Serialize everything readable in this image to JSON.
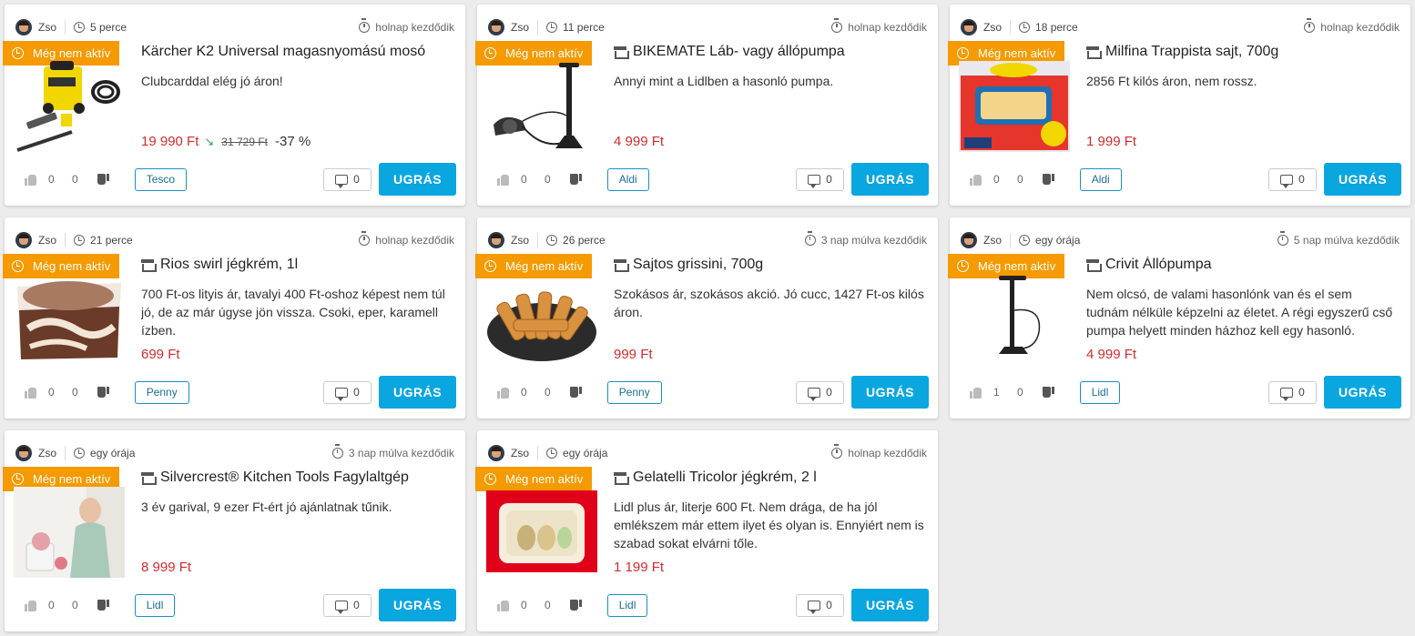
{
  "labels": {
    "inactive_badge": "Még nem aktív",
    "go_button": "UGRÁS"
  },
  "colors": {
    "badge": "#f59a00",
    "price": "#d42b2b",
    "button": "#0aa6e0"
  },
  "deals": [
    {
      "user": "Zso",
      "posted": "5 perce",
      "starts": "holnap kezdődik",
      "store_icon": false,
      "title": "Kärcher K2 Universal magasnyomású mosó",
      "description": "Clubcarddal elég jó áron!",
      "price": "19 990 Ft",
      "old_price": "31 729 Ft",
      "discount": "-37 %",
      "likes": "0",
      "dislikes": "0",
      "shop": "Tesco",
      "comments": "0",
      "image_icon": "pressure-washer-image"
    },
    {
      "user": "Zso",
      "posted": "11 perce",
      "starts": "holnap kezdődik",
      "store_icon": true,
      "title": "BIKEMATE Láb- vagy állópumpa",
      "description": "Annyi mint a Lidlben a hasonló pumpa.",
      "price": "4 999 Ft",
      "likes": "0",
      "dislikes": "0",
      "shop": "Aldi",
      "comments": "0",
      "image_icon": "bike-pump-image"
    },
    {
      "user": "Zso",
      "posted": "18 perce",
      "starts": "holnap kezdődik",
      "store_icon": true,
      "title": "Milfina Trappista sajt, 700g",
      "description": "2856 Ft kilós áron, nem rossz.",
      "price": "1 999 Ft",
      "likes": "0",
      "dislikes": "0",
      "shop": "Aldi",
      "comments": "0",
      "image_icon": "cheese-image"
    },
    {
      "user": "Zso",
      "posted": "21 perce",
      "starts": "holnap kezdődik",
      "store_icon": true,
      "title": "Rios swirl jégkrém, 1l",
      "description": "700 Ft-os lityis ár, tavalyi 400 Ft-oshoz képest nem túl jó, de az már úgyse jön vissza. Csoki, eper, karamell ízben.",
      "price": "699 Ft",
      "likes": "0",
      "dislikes": "0",
      "shop": "Penny",
      "comments": "0",
      "image_icon": "ice-cream-image"
    },
    {
      "user": "Zso",
      "posted": "26 perce",
      "starts": "3 nap múlva kezdődik",
      "store_icon": true,
      "title": "Sajtos grissini, 700g",
      "description": "Szokásos ár, szokásos akció. Jó cucc, 1427 Ft-os kilós áron.",
      "price": "999 Ft",
      "likes": "0",
      "dislikes": "0",
      "shop": "Penny",
      "comments": "0",
      "image_icon": "grissini-image"
    },
    {
      "user": "Zso",
      "posted": "egy órája",
      "starts": "5 nap múlva kezdődik",
      "store_icon": true,
      "title": "Crivit Állópumpa",
      "description": "Nem olcsó, de valami hasonlónk van és el sem tudnám nélküle képzelni az életet. A régi egyszerű cső pumpa helyett minden házhoz kell egy hasonló.",
      "price": "4 999 Ft",
      "likes": "1",
      "dislikes": "0",
      "shop": "Lidl",
      "comments": "0",
      "image_icon": "floor-pump-image"
    },
    {
      "user": "Zso",
      "posted": "egy órája",
      "starts": "3 nap múlva kezdődik",
      "store_icon": true,
      "title": "Silvercrest® Kitchen Tools Fagylaltgép",
      "description": "3 év garival, 9 ezer Ft-ért jó ajánlatnak tűnik.",
      "price": "8 999 Ft",
      "likes": "0",
      "dislikes": "0",
      "shop": "Lidl",
      "comments": "0",
      "image_icon": "ice-cream-maker-image"
    },
    {
      "user": "Zso",
      "posted": "egy órája",
      "starts": "holnap kezdődik",
      "store_icon": true,
      "title": "Gelatelli Tricolor jégkrém, 2 l",
      "description": "Lidl plus ár, literje 600 Ft. Nem drága, de ha jól emlékszem már ettem ilyet és olyan is. Ennyiért nem is szabad sokat elvárni tőle.",
      "price": "1 199 Ft",
      "likes": "0",
      "dislikes": "0",
      "shop": "Lidl",
      "comments": "0",
      "image_icon": "ice-cream-box-image"
    }
  ]
}
